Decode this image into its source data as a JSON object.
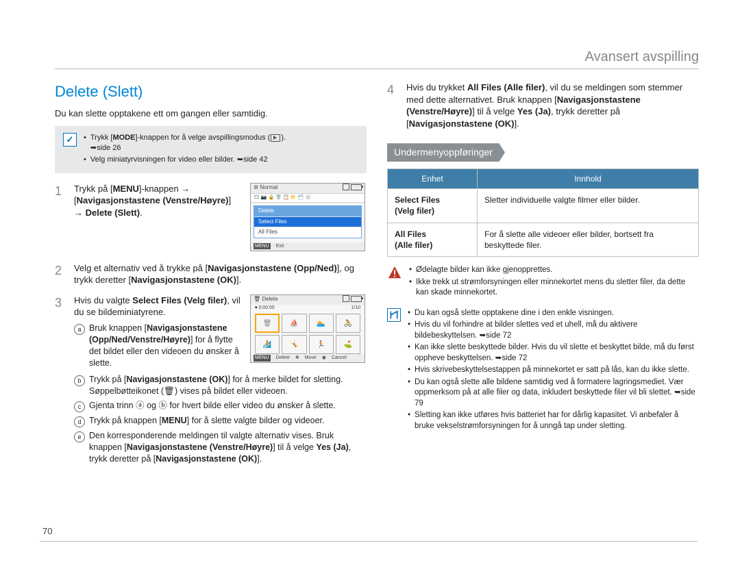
{
  "header": {
    "section": "Avansert avspilling"
  },
  "page_number": "70",
  "left": {
    "section_title": "Delete (Slett)",
    "intro": "Du kan slette opptakene ett om gangen eller samtidig.",
    "pre_note": {
      "items": [
        {
          "text_parts": [
            "Trykk [",
            "MODE",
            "]-knappen for å velge avspillingsmodus ("
          ],
          "tail": ").",
          "ref": "➥side 26"
        },
        {
          "text": "Velg miniatyrvisningen for video eller bilder.",
          "ref": "➥side 42"
        }
      ]
    },
    "steps": [
      {
        "n": "1",
        "body": "Trykk på [<b>MENU</b>]-knappen → [<b>Navigasjonstastene (Venstre/Høyre)</b>] → <b>Delete (Slett)</b>."
      },
      {
        "n": "2",
        "body": "Velg et alternativ ved å trykke på [<b>Navigasjonstastene (Opp/Ned)</b>], og trykk deretter [<b>Navigasjonstastene (OK)</b>]."
      },
      {
        "n": "3",
        "body": "Hvis du valgte <b>Select Files (Velg filer)</b>, vil du se bildeminiatyrene.",
        "subs": [
          {
            "l": "a",
            "body": "Bruk knappen [<b>Navigasjonstastene (Opp/Ned/Venstre/Høyre)</b>] for å flytte det bildet eller den videoen du ønsker å slette."
          },
          {
            "l": "b",
            "body": "Trykk på [<b>Navigasjonstastene (OK)</b>] for å merke bildet for sletting. Søppelbøtteikonet (🗑) vises på bildet eller videoen."
          },
          {
            "l": "c",
            "body": "Gjenta trinn ⓐ og ⓑ for hvert bilde eller video du ønsker å slette."
          },
          {
            "l": "d",
            "body": "Trykk på knappen [<b>MENU</b>] for å slette valgte bilder og videoer."
          },
          {
            "l": "e",
            "body": "Den korresponderende meldingen til valgte alternativ vises. Bruk knappen [<b>Navigasjonstastene (Venstre/Høyre)</b>] til å velge <b>Yes (Ja)</b>, trykk deretter på [<b>Navigasjonstastene (OK)</b>]."
          }
        ]
      }
    ],
    "mock1": {
      "top_left": "Normal",
      "menu_title": "Delete",
      "item_selected": "Select Files",
      "item2": "All Files",
      "bottom_left_tag": "MENU",
      "bottom_left": "Exit"
    },
    "mock2": {
      "top_left": "Delete",
      "time": "0:00:55",
      "counter": "1/10",
      "thumbs": [
        "🗑",
        "⛵",
        "🏊",
        "🚴",
        "🏄",
        "🤸",
        "🏃",
        "⛳"
      ],
      "bottom": {
        "tag1": "MENU",
        "l1": "Delete",
        "mid_icon": "✥",
        "mid": "Move",
        "r_icon": "◉",
        "r": "Cancel"
      }
    }
  },
  "right": {
    "step4": {
      "n": "4",
      "body": "Hvis du trykket <b>All Files (Alle filer)</b>, vil du se meldingen som stemmer med dette alternativet. Bruk knappen [<b>Navigasjonstastene (Venstre/Høyre)</b>] til å velge <b>Yes (Ja)</b>, trykk deretter på [<b>Navigasjonstastene (OK)</b>]."
    },
    "sub_ribbon": "Undermenyoppføringer",
    "table": {
      "head": {
        "c1": "Enhet",
        "c2": "Innhold"
      },
      "rows": [
        {
          "k1": "Select Files",
          "k2": "(Velg filer)",
          "v": "Sletter individuelle valgte filmer eller bilder."
        },
        {
          "k1": "All Files",
          "k2": "(Alle filer)",
          "v": "For å slette alle videoer eller bilder, bortsett fra beskyttede filer."
        }
      ]
    },
    "warning": {
      "items": [
        "Ødelagte bilder kan ikke gjenopprettes.",
        "Ikke trekk ut strømforsyningen eller minnekortet mens du sletter filer, da dette kan skade minnekortet."
      ]
    },
    "info": {
      "items": [
        "Du kan også slette opptakene dine i den enkle visningen.",
        "Hvis du vil forhindre at bilder slettes ved et uhell, må du aktivere bildebeskyttelsen. ➥side 72",
        "Kan ikke slette beskyttede bilder. Hvis du vil slette et beskyttet bilde, må du først oppheve beskyttelsen. ➥side 72",
        "Hvis skrivebeskyttelsestappen på minnekortet er satt på lås, kan du ikke slette.",
        "Du kan også slette alle bildene samtidig ved å formatere lagringsmediet. Vær oppmerksom på at alle filer og data, inkludert beskyttede filer vil bli slettet. ➥side 79",
        "Sletting kan ikke utføres hvis batteriet har for dårlig kapasitet. Vi anbefaler å bruke vekselstrømforsyningen for å unngå tap under sletting."
      ]
    }
  }
}
